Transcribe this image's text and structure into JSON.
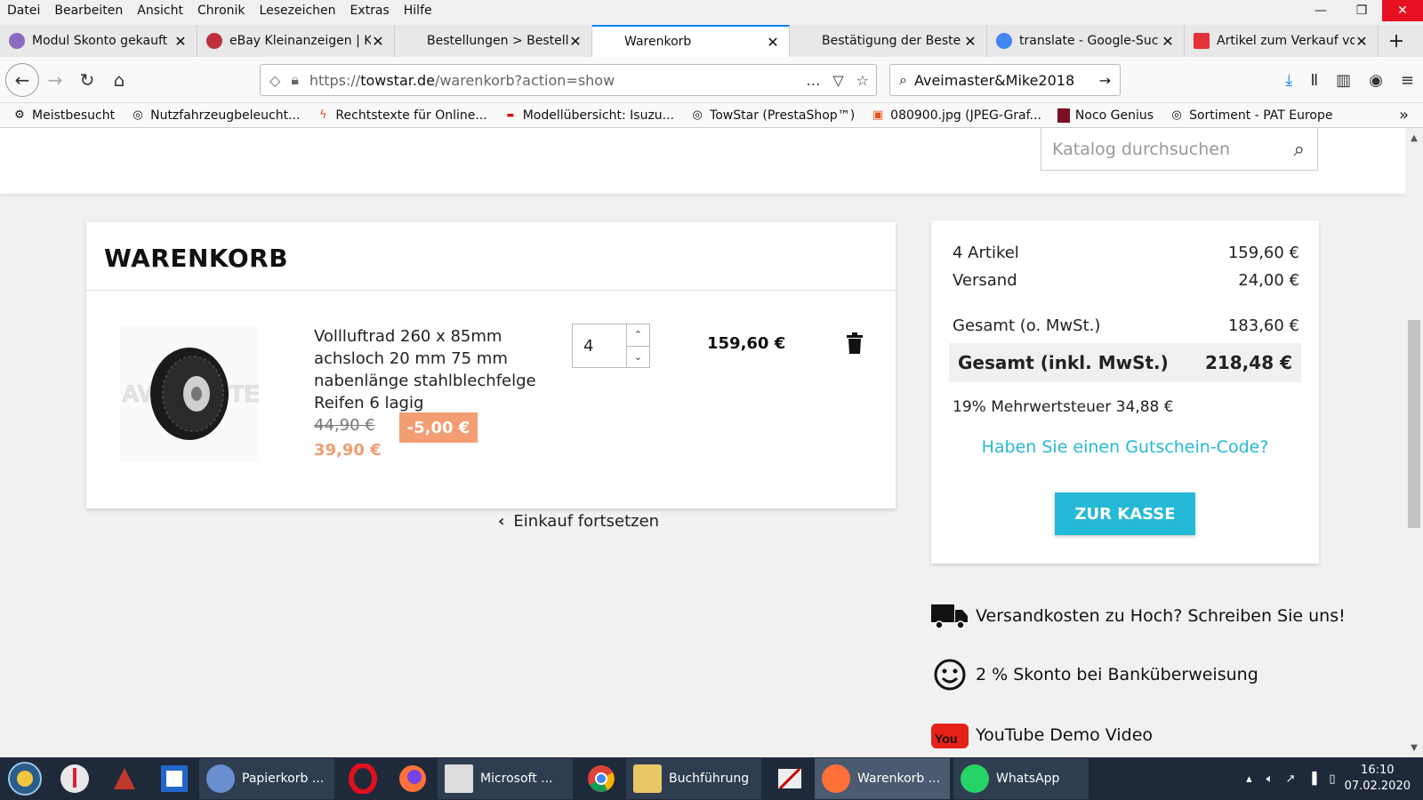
{
  "menubar": {
    "items": [
      "Datei",
      "Bearbeiten",
      "Ansicht",
      "Chronik",
      "Lesezeichen",
      "Extras",
      "Hilfe"
    ]
  },
  "tabs": [
    {
      "label": "Modul Skonto gekauft",
      "color": "#8a6bbf"
    },
    {
      "label": "eBay Kleinanzeigen | K",
      "color": "#c0303a"
    },
    {
      "label": "Bestellungen > Bestell",
      "color": ""
    },
    {
      "label": "Warenkorb",
      "color": ""
    },
    {
      "label": "Bestätigung der Beste",
      "color": ""
    },
    {
      "label": "translate - Google-Suc",
      "color": "#4285f4"
    },
    {
      "label": "Artikel zum Verkauf vo",
      "color": "#e53238"
    }
  ],
  "url": {
    "prefix": "https://",
    "domain": "towstar.de",
    "path": "/warenkorb?action=show"
  },
  "search": {
    "value": "Aveimaster&Mike2018"
  },
  "bookmarks": [
    {
      "label": "Meistbesucht",
      "icon": "gear-icon"
    },
    {
      "label": "Nutzfahrzeugbeleucht...",
      "icon": "globe-icon"
    },
    {
      "label": "Rechtstexte für Online...",
      "icon": "bolt-icon"
    },
    {
      "label": "Modellübersicht: Isuzu...",
      "icon": "isuzu-icon"
    },
    {
      "label": "TowStar (PrestaShop™)",
      "icon": "globe-icon"
    },
    {
      "label": "080900.jpg (JPEG-Graf...",
      "icon": "image-icon"
    },
    {
      "label": "Noco Genius",
      "icon": "noco-icon"
    },
    {
      "label": "Sortiment - PAT Europe",
      "icon": "globe-icon"
    }
  ],
  "header": {
    "search_placeholder": "Katalog durchsuchen"
  },
  "cart": {
    "title": "WARENKORB",
    "item": {
      "name": "Vollluftrad 260 x 85mm achsloch 20 mm 75 mm nabenlänge stahlblechfelge Reifen 6 lagig",
      "old_price": "44,90 €",
      "discount": "-5,00 €",
      "new_price": "39,90 €",
      "quantity": "4",
      "line_total": "159,60 €",
      "image_watermark": "AVEIMASTER"
    },
    "continue_label": "Einkauf fortsetzen"
  },
  "summary": {
    "items_label": "4 Artikel",
    "items_value": "159,60 €",
    "shipping_label": "Versand",
    "shipping_value": "24,00 €",
    "net_label": "Gesamt (o. MwSt.)",
    "net_value": "183,60 €",
    "gross_label": "Gesamt (inkl. MwSt.)",
    "gross_value": "218,48 €",
    "tax_text": "19% Mehrwertsteuer 34,88 €",
    "voucher_label": "Haben Sie einen Gutschein-Code?",
    "checkout_label": "ZUR KASSE"
  },
  "reassurance": [
    {
      "label": "Versandkosten zu Hoch? Schreiben Sie uns!",
      "icon": "truck-icon"
    },
    {
      "label": "2 % Skonto bei Banküberweisung",
      "icon": "smiley-icon"
    },
    {
      "label": "YouTube Demo Video",
      "icon": "youtube-icon"
    }
  ],
  "taskbar": {
    "buttons": [
      {
        "label": "Papierkorb ...",
        "color": "#6a8fd0"
      },
      {
        "label": "Microsoft ...",
        "color": "#dddddd"
      },
      {
        "label": "Buchführung",
        "color": "#e8c766"
      },
      {
        "label": "Warenkorb ...",
        "color": "#ff7139"
      },
      {
        "label": "WhatsApp",
        "color": "#25d366"
      }
    ],
    "time": "16:10",
    "date": "07.02.2020"
  }
}
